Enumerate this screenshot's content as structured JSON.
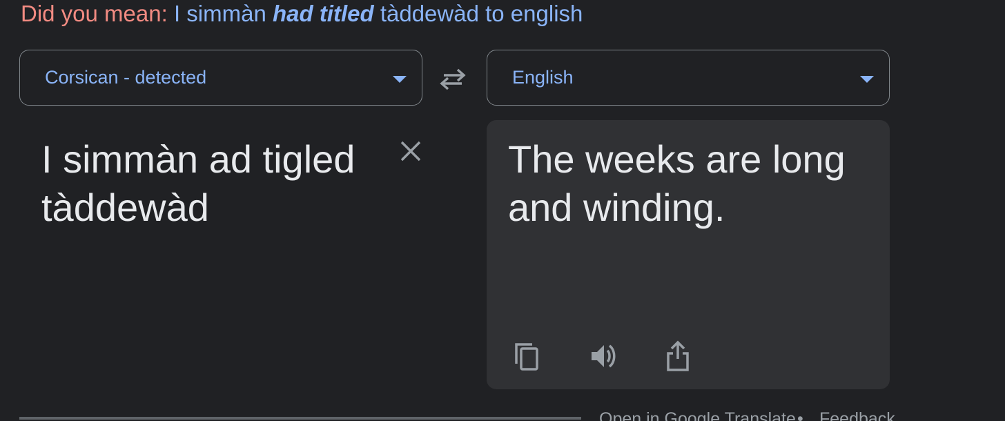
{
  "suggestion": {
    "prefix": "Did you mean:",
    "before": "I simmàn ",
    "emphasis": "had titled",
    "after": " tàddewàd to english"
  },
  "source_language": {
    "label": "Corsican - detected",
    "icon": "chevron-down-icon"
  },
  "target_language": {
    "label": "English",
    "icon": "chevron-down-icon"
  },
  "swap_icon": "swap-horiz-icon",
  "source_text": "I simmàn ad tigled tàddewàd",
  "clear_icon": "close-icon",
  "translation": {
    "text": "The weeks are long and winding.",
    "tools": [
      "copy-icon",
      "volume-icon",
      "share-icon"
    ]
  },
  "footer": {
    "open_link": "Open in Google Translate",
    "separator": "•",
    "feedback_link": "Feedback"
  },
  "colors": {
    "background": "#202124",
    "result_panel": "#303134",
    "accent": "#8ab4f8",
    "did_you_mean": "#f28b82",
    "text": "#e8eaed",
    "muted": "#9aa0a6"
  }
}
